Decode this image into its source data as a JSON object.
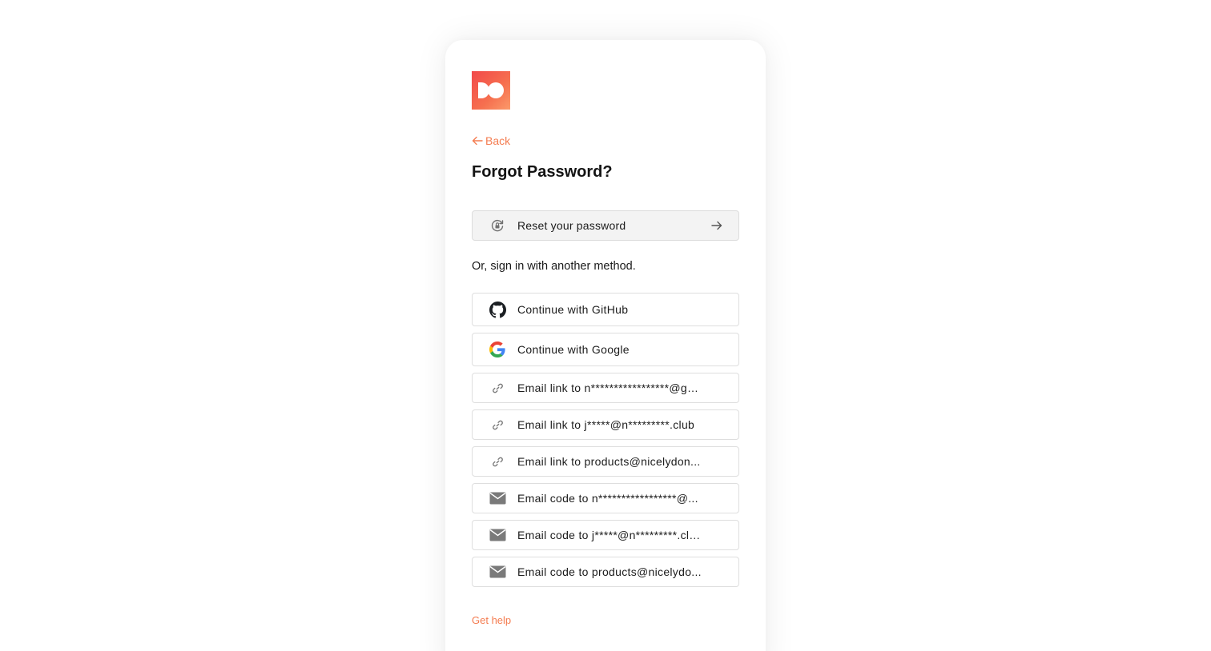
{
  "brand": {
    "logo_icon": "dribbble-style-logo",
    "accent_color": "#f47c50",
    "logo_gradient": [
      "#f2494a",
      "#fb9a6a"
    ]
  },
  "nav": {
    "back_label": "Back"
  },
  "page": {
    "title": "Forgot Password?"
  },
  "reset": {
    "label": "Reset your password",
    "icon": "lock-reset-icon",
    "trailing_icon": "arrow-right-icon"
  },
  "alternate": {
    "prompt": "Or, sign in with another method.",
    "methods": [
      {
        "label": "Continue with GitHub",
        "icon": "github-icon"
      },
      {
        "label": "Continue with Google",
        "icon": "google-icon"
      },
      {
        "label": "Email link to n*****************@g*...",
        "icon": "link-icon"
      },
      {
        "label": "Email link to j*****@n*********.club",
        "icon": "link-icon"
      },
      {
        "label": "Email link to products@nicelydon...",
        "icon": "link-icon"
      },
      {
        "label": "Email code to n*****************@...",
        "icon": "mail-icon"
      },
      {
        "label": "Email code to j*****@n*********.club",
        "icon": "mail-icon"
      },
      {
        "label": "Email code to products@nicelydo...",
        "icon": "mail-icon"
      }
    ]
  },
  "footer": {
    "help_label": "Get help"
  }
}
